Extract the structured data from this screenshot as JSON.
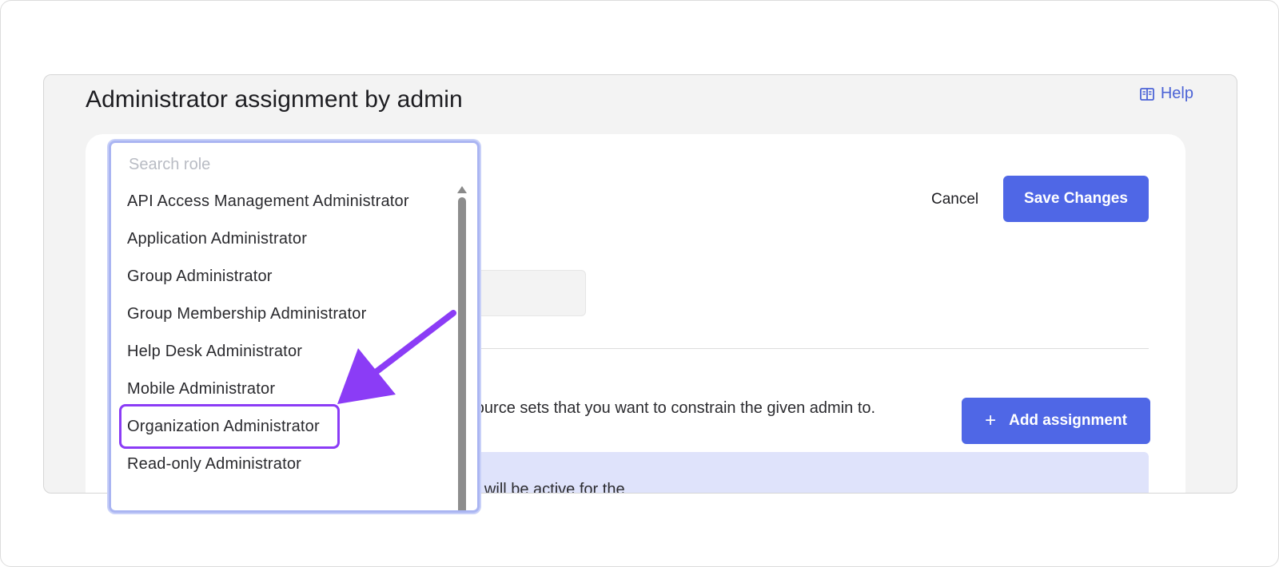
{
  "header": {
    "title": "Administrator assignment by admin",
    "help_label": "Help"
  },
  "toolbar": {
    "cancel_label": "Cancel",
    "save_label": "Save Changes"
  },
  "assignments": {
    "description": "resource sets that you want to constrain the given admin to.",
    "add_label": "Add assignment",
    "add_icon": "plus-icon",
    "info_text": "and will be active for the"
  },
  "dropdown": {
    "search_placeholder": "Search role",
    "roles": [
      "API Access Management Administrator",
      "Application Administrator",
      "Group Administrator",
      "Group Membership Administrator",
      "Help Desk Administrator",
      "Mobile Administrator",
      "Organization Administrator",
      "Read-only Administrator"
    ],
    "highlighted_role": "Organization Administrator"
  },
  "annotation": {
    "arrow_color": "#8b3cf6",
    "highlight_color": "#8b3cf6"
  },
  "colors": {
    "primary": "#4f67e6",
    "info_background": "#dfe3fb",
    "focus_border": "#aab5f2"
  }
}
